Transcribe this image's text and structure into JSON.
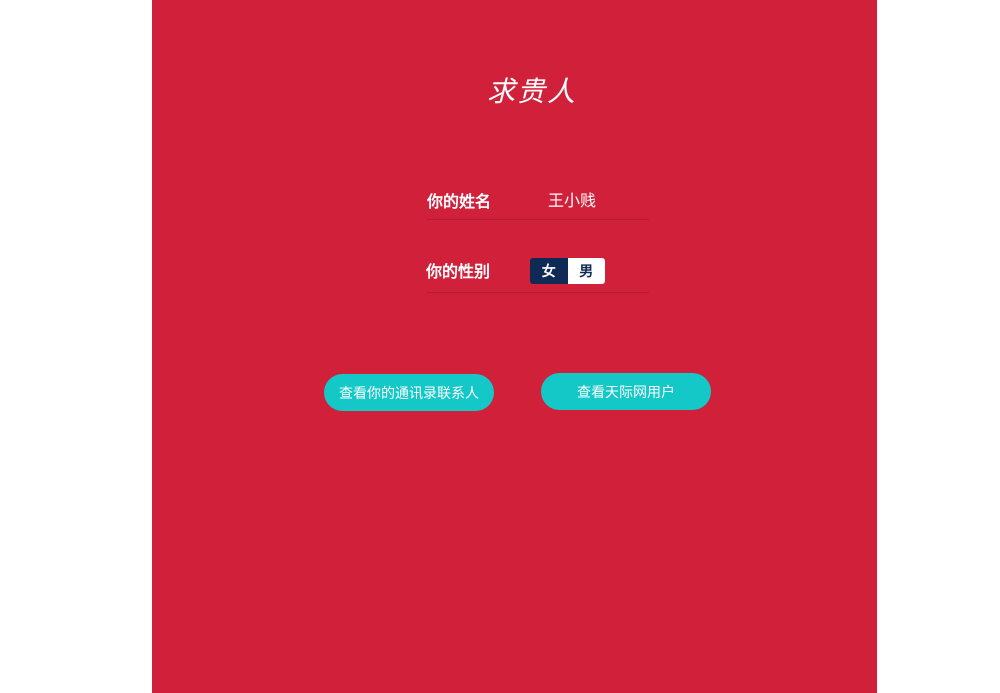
{
  "app": {
    "title": "求贵人"
  },
  "form": {
    "name_label": "你的姓名",
    "name_value": "王小贱",
    "gender_label": "你的性别",
    "gender_options": [
      "女",
      "男"
    ],
    "gender_selected": "女"
  },
  "actions": {
    "contacts_button": "查看你的通讯录联系人",
    "users_button": "查看天际网用户"
  },
  "colors": {
    "panel_bg": "#d0203a",
    "button_bg": "#14c8c8",
    "selected_bg": "#0f2a55"
  }
}
